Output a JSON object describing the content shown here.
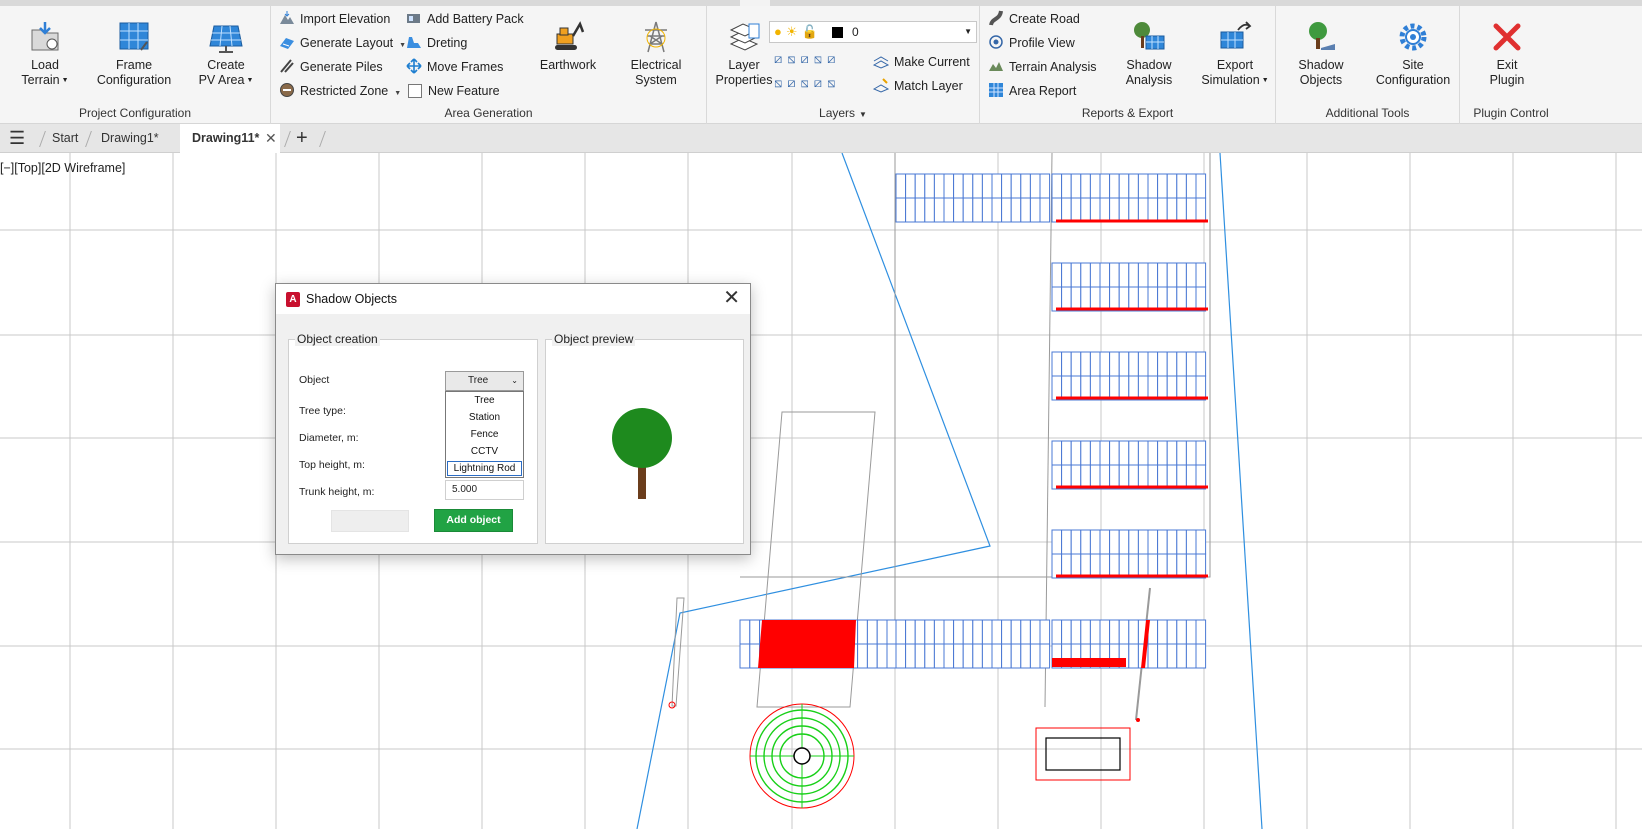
{
  "ribbon": {
    "project_configuration": {
      "label": "Project Configuration",
      "load_terrain": "Load\nTerrain",
      "frame_configuration_line1": "Frame",
      "frame_configuration_line2": "Configuration",
      "create_pv_area_line1": "Create",
      "create_pv_area_line2": "PV Area",
      "load_terrain_line1": "Load",
      "load_terrain_line2": "Terrain"
    },
    "area_generation": {
      "label": "Area Generation",
      "import_elevation": "Import Elevation",
      "generate_layout": "Generate Layout",
      "generate_piles": "Generate Piles",
      "restricted_zone": "Restricted Zone",
      "add_battery_pack": "Add Battery Pack",
      "dreting": "Dreting",
      "move_frames": "Move Frames",
      "new_feature": "New Feature",
      "earthwork": "Earthwork",
      "electrical_line1": "Electrical",
      "electrical_line2": "System"
    },
    "layers": {
      "label": "Layers",
      "layer_properties_line1": "Layer",
      "layer_properties_line2": "Properties",
      "current_layer": "0",
      "make_current": "Make Current",
      "match_layer": "Match Layer"
    },
    "reports_export": {
      "label": "Reports & Export",
      "create_road": "Create Road",
      "profile_view": "Profile View",
      "terrain_analysis": "Terrain Analysis",
      "area_report": "Area Report",
      "shadow_analysis_line1": "Shadow",
      "shadow_analysis_line2": "Analysis",
      "export_simulation_line1": "Export",
      "export_simulation_line2": "Simulation"
    },
    "additional_tools": {
      "label": "Additional Tools",
      "shadow_objects_line1": "Shadow",
      "shadow_objects_line2": "Objects",
      "site_configuration_line1": "Site",
      "site_configuration_line2": "Configuration"
    },
    "plugin_control": {
      "label": "Plugin Control",
      "exit_plugin_line1": "Exit",
      "exit_plugin_line2": "Plugin"
    }
  },
  "tabs": {
    "start": "Start",
    "drawing1": "Drawing1*",
    "drawing11": "Drawing11*",
    "close_glyph": "✕",
    "add_glyph": "+"
  },
  "viewport": {
    "label": "[−][Top][2D Wireframe]"
  },
  "dialog": {
    "title": "Shadow Objects",
    "object_creation": "Object creation",
    "object_preview": "Object preview",
    "object_label": "Object",
    "object_value": "Tree",
    "tree_type_label": "Tree type:",
    "diameter_label": "Diameter, m:",
    "top_height_label": "Top height, m:",
    "trunk_height_label": "Trunk height, m:",
    "trunk_height_value": "5.000",
    "options": [
      "Tree",
      "Station",
      "Fence",
      "CCTV",
      "Lightning Rod"
    ],
    "highlighted_option": "Lightning Rod",
    "add_object": "Add object",
    "disabled_button": "",
    "tree_crown_color": "#1e8a1e",
    "tree_trunk_color": "#6b3d1c"
  },
  "colors": {
    "accent_green": "#21a344",
    "frame_blue": "#4a78d4",
    "highlight_red": "#ff0000",
    "line_blue": "#2f8fe0"
  },
  "icons": {
    "load_terrain": "folder-download-icon",
    "frame_configuration": "solar-panel-icon",
    "create_pv_area": "solar-array-icon",
    "earthwork": "excavator-icon",
    "electrical_system": "transmission-tower-icon",
    "layer_properties": "layers-icon",
    "shadow_analysis": "tree-panel-icon",
    "export_simulation": "export-panel-icon",
    "shadow_objects": "tree-shadow-icon",
    "site_configuration": "gear-icon",
    "exit_plugin": "red-x-icon"
  }
}
